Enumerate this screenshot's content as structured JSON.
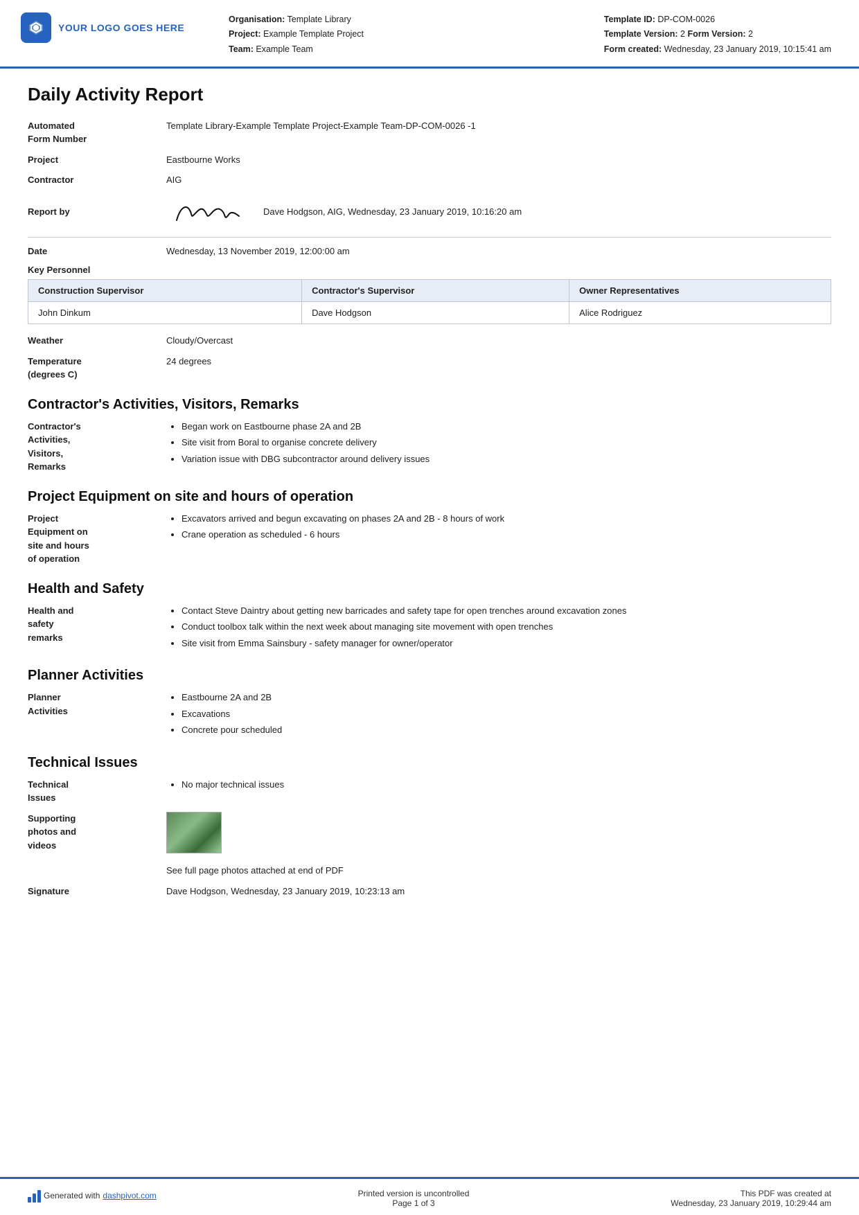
{
  "header": {
    "logo_text": "YOUR LOGO GOES HERE",
    "org_label": "Organisation:",
    "org_value": "Template Library",
    "project_label": "Project:",
    "project_value": "Example Template Project",
    "team_label": "Team:",
    "team_value": "Example Team",
    "template_id_label": "Template ID:",
    "template_id_value": "DP-COM-0026",
    "template_version_label": "Template Version:",
    "template_version_value": "2",
    "form_version_label": "Form Version:",
    "form_version_value": "2",
    "form_created_label": "Form created:",
    "form_created_value": "Wednesday, 23 January 2019, 10:15:41 am"
  },
  "doc_title": "Daily Activity Report",
  "fields": {
    "automated_label": "Automated\nForm Number",
    "automated_value": "Template Library-Example Template Project-Example Team-DP-COM-0026   -1",
    "project_label": "Project",
    "project_value": "Eastbourne Works",
    "contractor_label": "Contractor",
    "contractor_value": "AIG",
    "report_by_label": "Report by",
    "report_by_text": "Dave Hodgson, AIG, Wednesday, 23 January 2019, 10:16:20 am",
    "date_label": "Date",
    "date_value": "Wednesday, 13 November 2019, 12:00:00 am"
  },
  "key_personnel": {
    "label": "Key Personnel",
    "columns": [
      "Construction Supervisor",
      "Contractor's Supervisor",
      "Owner Representatives"
    ],
    "rows": [
      [
        "John Dinkum",
        "Dave Hodgson",
        "Alice Rodriguez"
      ]
    ]
  },
  "weather_label": "Weather",
  "weather_value": "Cloudy/Overcast",
  "temperature_label": "Temperature\n(degrees C)",
  "temperature_value": "24 degrees",
  "sections": [
    {
      "heading": "Contractor's Activities, Visitors, Remarks",
      "field_label": "Contractor's\nActivities,\nVisitors,\nRemarks",
      "bullets": [
        "Began work on Eastbourne phase 2A and 2B",
        "Site visit from Boral to organise concrete delivery",
        "Variation issue with DBG subcontractor around delivery issues"
      ]
    },
    {
      "heading": "Project Equipment on site and hours of operation",
      "field_label": "Project\nEquipment on\nsite and hours\nof operation",
      "bullets": [
        "Excavators arrived and begun excavating on phases 2A and 2B - 8 hours of work",
        "Crane operation as scheduled - 6 hours"
      ]
    },
    {
      "heading": "Health and Safety",
      "field_label": "Health and\nsafety\nremarks",
      "bullets": [
        "Contact Steve Daintry about getting new barricades and safety tape for open trenches around excavation zones",
        "Conduct toolbox talk within the next week about managing site movement with open trenches",
        "Site visit from Emma Sainsbury - safety manager for owner/operator"
      ]
    },
    {
      "heading": "Planner Activities",
      "field_label": "Planner\nActivities",
      "bullets": [
        "Eastbourne 2A and 2B",
        "Excavations",
        "Concrete pour scheduled"
      ]
    }
  ],
  "technical_issues": {
    "heading": "Technical Issues",
    "label": "Technical\nIssues",
    "bullets": [
      "No major technical issues"
    ],
    "photos_label": "Supporting\nphotos and\nvideos",
    "photos_caption": "See full page photos attached at end of PDF",
    "signature_label": "Signature",
    "signature_value": "Dave Hodgson, Wednesday, 23 January 2019, 10:23:13 am"
  },
  "footer": {
    "generated_text": "Generated with ",
    "link_text": "dashpivot.com",
    "center_line1": "Printed version is uncontrolled",
    "center_line2": "Page 1 of 3",
    "right_line1": "This PDF was created at",
    "right_line2": "Wednesday, 23 January 2019, 10:29:44 am"
  }
}
